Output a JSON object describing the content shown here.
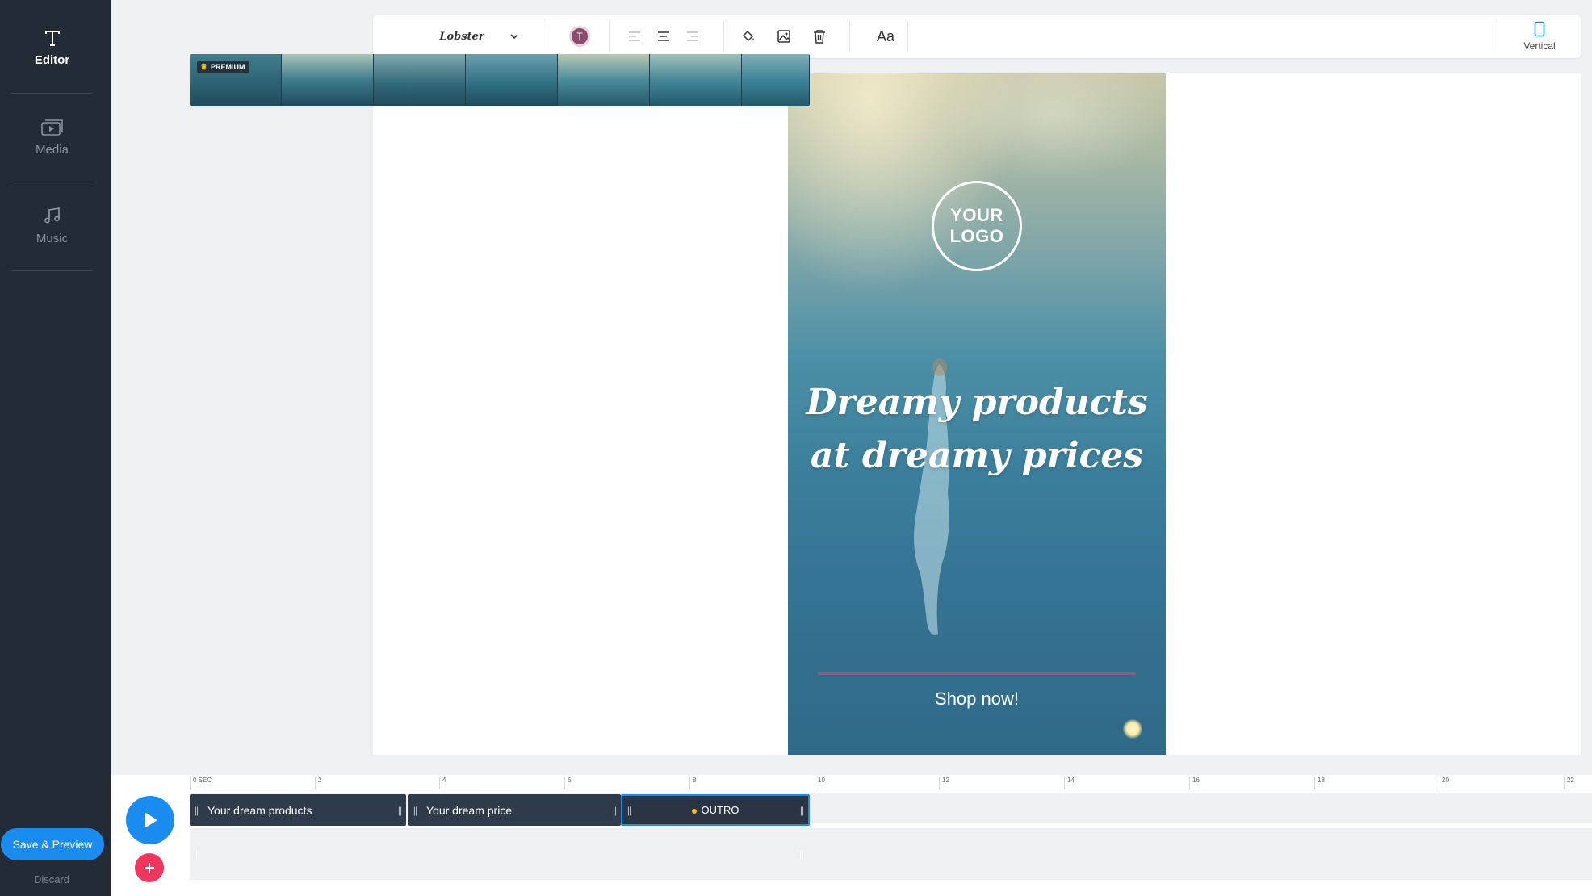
{
  "sidebar": {
    "items": [
      {
        "label": "Editor",
        "icon": "text-icon",
        "active": true
      },
      {
        "label": "Media",
        "icon": "media-icon",
        "active": false
      },
      {
        "label": "Music",
        "icon": "music-note-icon",
        "active": false
      }
    ],
    "save_label": "Save & Preview",
    "discard_label": "Discard"
  },
  "toolbar": {
    "font": "Lobster",
    "color_letter": "T",
    "color_value": "#8b4a6e",
    "aa_label": "Aa",
    "orientation_label": "Vertical"
  },
  "canvas": {
    "logo_line1": "YOUR",
    "logo_line2": "LOGO",
    "headline_line1": "Dreamy products",
    "headline_line2": "at dreamy prices",
    "cta": "Shop now!"
  },
  "timeline": {
    "ticks": [
      "0 SEC",
      "2",
      "4",
      "6",
      "8",
      "10",
      "12",
      "14",
      "16",
      "18",
      "20",
      "22"
    ],
    "clips": [
      {
        "label": "Your dream products"
      },
      {
        "label": "Your dream price"
      },
      {
        "label": "OUTRO"
      }
    ],
    "media_badge": "PREMIUM"
  },
  "colors": {
    "accent": "#1a8cf0",
    "add": "#f0365c",
    "sidebar_bg": "#222b36",
    "cta_line": "#a45378"
  }
}
